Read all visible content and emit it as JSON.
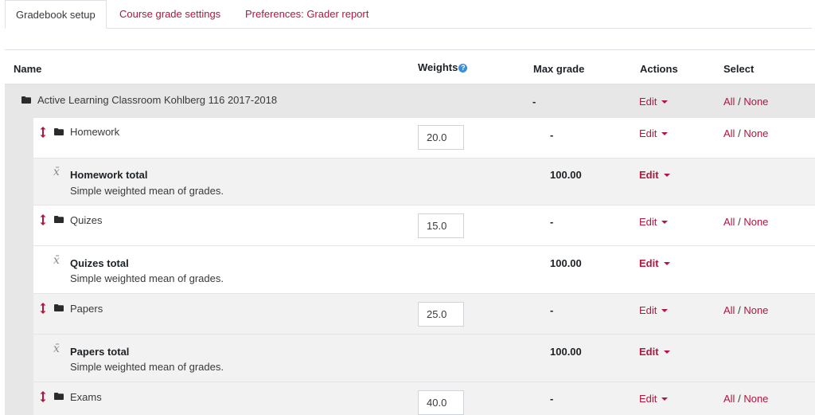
{
  "tabs": [
    {
      "label": "Gradebook setup",
      "active": true
    },
    {
      "label": "Course grade settings",
      "active": false
    },
    {
      "label": "Preferences: Grader report",
      "active": false
    }
  ],
  "table": {
    "headers": {
      "name": "Name",
      "weights": "Weights",
      "max_grade": "Max grade",
      "actions": "Actions",
      "select": "Select"
    },
    "course": {
      "name": "Active Learning Classroom Kohlberg 116 2017-2018",
      "max_grade": "-",
      "edit": "Edit",
      "select_all": "All",
      "select_sep": "/",
      "select_none": "None"
    },
    "rows": [
      {
        "type": "category",
        "name": "Homework",
        "weight": "20.0",
        "max_grade": "-",
        "edit": "Edit",
        "select_all": "All",
        "select_sep": "/",
        "select_none": "None"
      },
      {
        "type": "total",
        "name": "Homework total",
        "desc": "Simple weighted mean of grades.",
        "max_grade": "100.00",
        "edit": "Edit"
      },
      {
        "type": "category",
        "name": "Quizes",
        "weight": "15.0",
        "max_grade": "-",
        "edit": "Edit",
        "select_all": "All",
        "select_sep": "/",
        "select_none": "None"
      },
      {
        "type": "total",
        "name": "Quizes total",
        "desc": "Simple weighted mean of grades.",
        "max_grade": "100.00",
        "edit": "Edit"
      },
      {
        "type": "category",
        "name": "Papers",
        "weight": "25.0",
        "max_grade": "-",
        "edit": "Edit",
        "select_all": "All",
        "select_sep": "/",
        "select_none": "None"
      },
      {
        "type": "total",
        "name": "Papers total",
        "desc": "Simple weighted mean of grades.",
        "max_grade": "100.00",
        "edit": "Edit"
      },
      {
        "type": "category",
        "name": "Exams",
        "weight": "40.0",
        "max_grade": "-",
        "edit": "Edit",
        "select_all": "All",
        "select_sep": "/",
        "select_none": "None"
      }
    ]
  },
  "icons": {
    "folder": "folder-icon",
    "move": "move-icon",
    "mean": "mean-x-bar-icon",
    "help": "help-icon",
    "caret": "caret-down-icon"
  },
  "colors": {
    "link": "#b0163e",
    "help": "#3d8fd6"
  }
}
